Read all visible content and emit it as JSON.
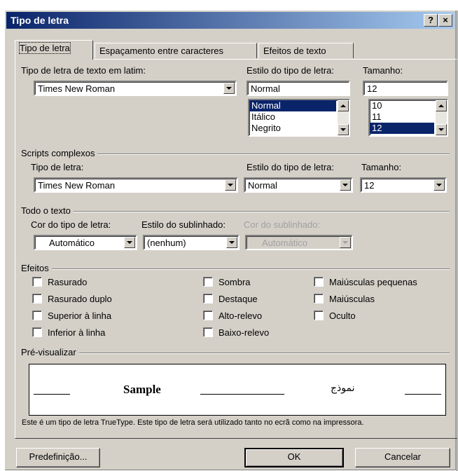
{
  "window": {
    "title": "Tipo de letra",
    "help_label": "?",
    "close_label": "×"
  },
  "tabs": [
    {
      "label": "Tipo de letra",
      "active": true
    },
    {
      "label": "Espaçamento entre caracteres",
      "active": false
    },
    {
      "label": "Efeitos de texto",
      "active": false
    }
  ],
  "latin": {
    "font_label": "Tipo de letra de texto em latim:",
    "font_value": "Times New Roman",
    "style_label": "Estilo do tipo de letra:",
    "style_value": "Normal",
    "style_options": [
      "Normal",
      "Itálico",
      "Negrito"
    ],
    "style_selected": "Normal",
    "size_label": "Tamanho:",
    "size_value": "12",
    "size_options": [
      "10",
      "11",
      "12"
    ],
    "size_selected": "12"
  },
  "complex": {
    "group_label": "Scripts complexos",
    "font_label": "Tipo de letra:",
    "font_value": "Times New Roman",
    "style_label": "Estilo do tipo de letra:",
    "style_value": "Normal",
    "size_label": "Tamanho:",
    "size_value": "12"
  },
  "all_text": {
    "group_label": "Todo o texto",
    "color_label": "Cor do tipo de letra:",
    "color_value": "Automático",
    "underline_label": "Estilo do sublinhado:",
    "underline_value": "(nenhum)",
    "underline_color_label": "Cor do sublinhado:",
    "underline_color_value": "Automático"
  },
  "effects": {
    "group_label": "Efeitos",
    "items": [
      "Rasurado",
      "Rasurado duplo",
      "Superior à linha",
      "Inferior à linha",
      "Sombra",
      "Destaque",
      "Alto-relevo",
      "Baixo-relevo",
      "Maiúsculas pequenas",
      "Maiúsculas",
      "Oculto"
    ]
  },
  "preview": {
    "group_label": "Pré-visualizar",
    "sample": "Sample",
    "arabic_sample": "نموذج",
    "note": "Este é um tipo de letra TrueType. Este tipo de letra será utilizado tanto no ecrã como na impressora."
  },
  "buttons": {
    "default_label": "Predefinição...",
    "ok_label": "OK",
    "cancel_label": "Cancelar"
  }
}
